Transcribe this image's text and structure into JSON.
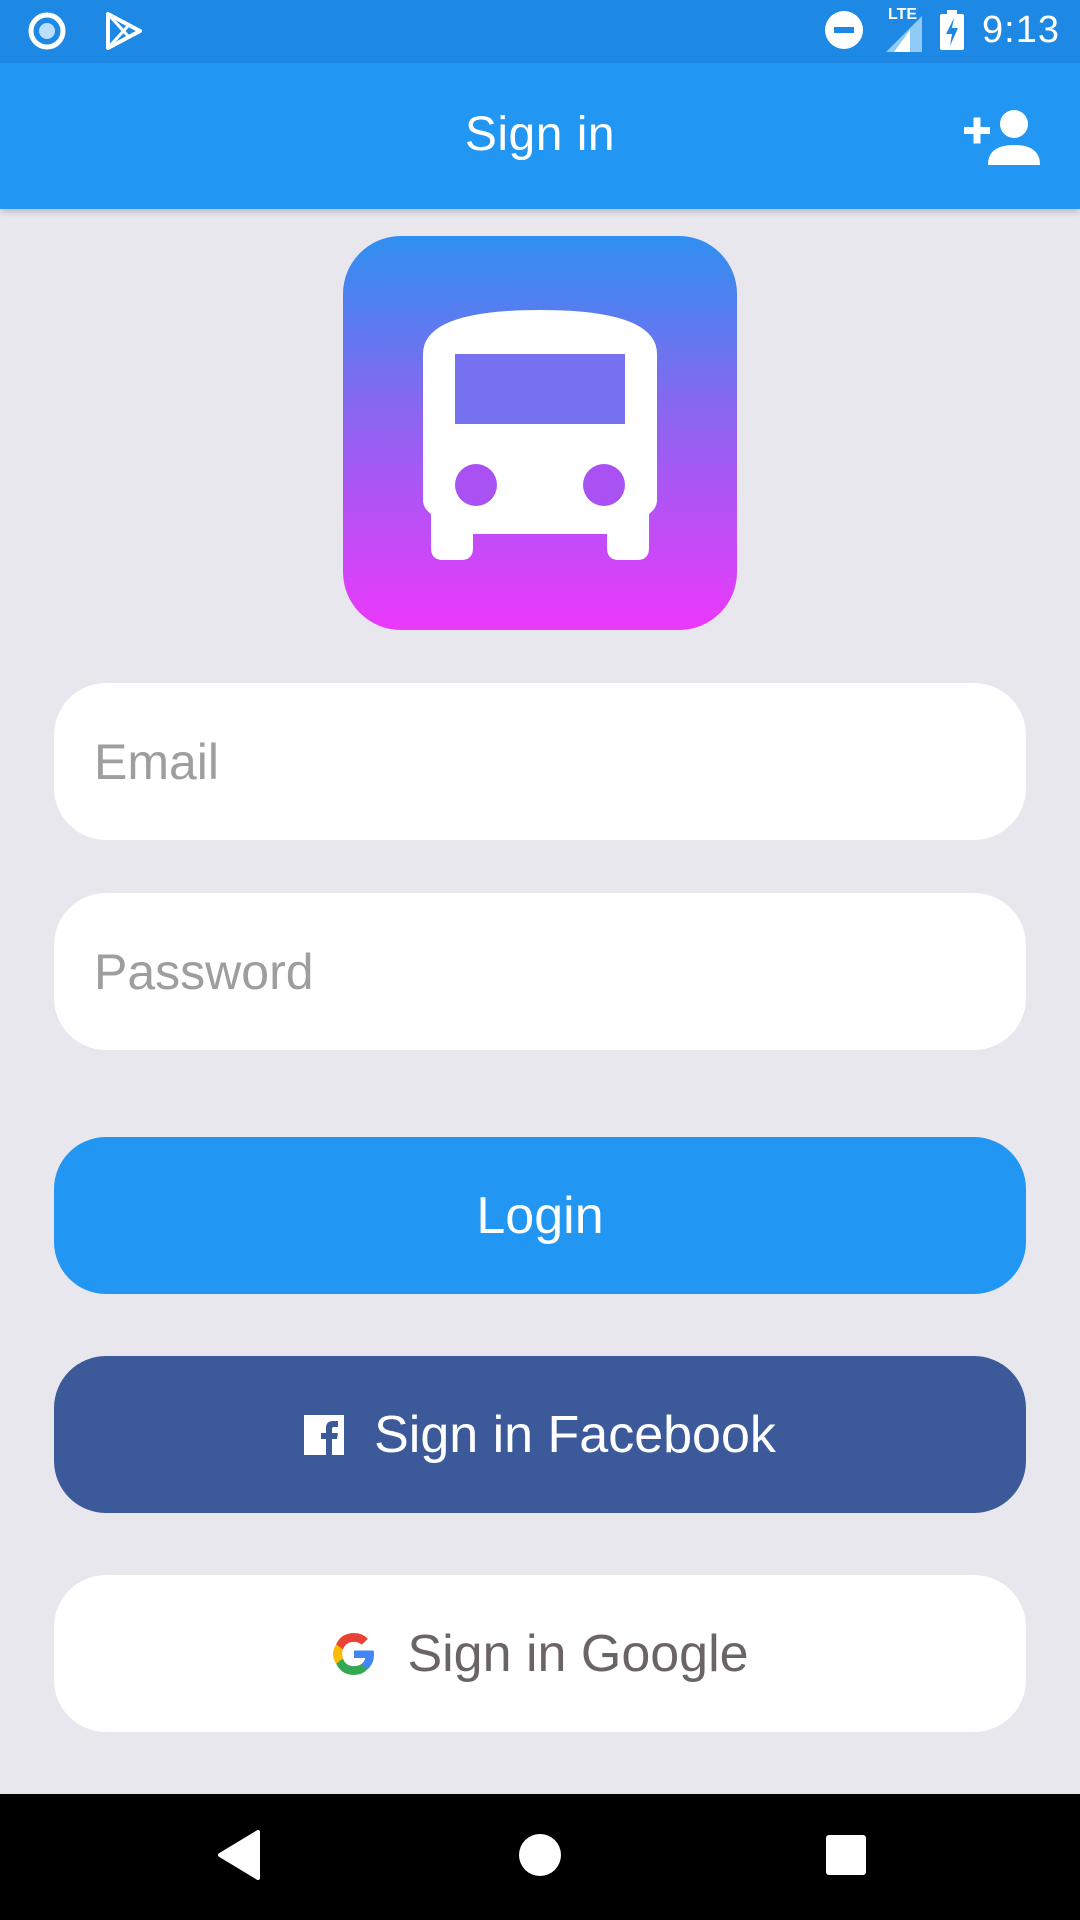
{
  "status_bar": {
    "time": "9:13",
    "network": "LTE",
    "icons": [
      "circle-app-icon",
      "play-store-icon",
      "do-not-disturb-icon",
      "signal-icon",
      "battery-charging-icon"
    ]
  },
  "app_bar": {
    "title": "Sign in",
    "action_icon": "add-user-icon"
  },
  "logo": {
    "icon": "bus-icon",
    "gradient": [
      "#2F8FF0",
      "#EC38FC"
    ]
  },
  "form": {
    "email": {
      "value": "",
      "placeholder": "Email"
    },
    "password": {
      "value": "",
      "placeholder": "Password"
    }
  },
  "buttons": {
    "login": "Login",
    "facebook": "Sign in Facebook",
    "google": "Sign in Google"
  },
  "nav_bar": {
    "icons": [
      "back-icon",
      "home-icon",
      "recents-icon"
    ]
  },
  "colors": {
    "primary": "#2196F3",
    "status_bar": "#1E88E5",
    "facebook": "#3C5A99",
    "background": "#E8E7EE"
  }
}
